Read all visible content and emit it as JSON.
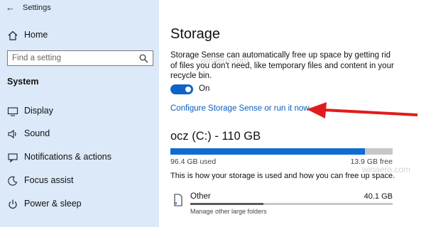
{
  "app": {
    "title": "Settings"
  },
  "sidebar": {
    "home_label": "Home",
    "search_placeholder": "Find a setting",
    "section_title": "System",
    "items": [
      {
        "label": "Display",
        "icon": "display-icon"
      },
      {
        "label": "Sound",
        "icon": "sound-icon"
      },
      {
        "label": "Notifications & actions",
        "icon": "notifications-icon"
      },
      {
        "label": "Focus assist",
        "icon": "focus-assist-icon"
      },
      {
        "label": "Power & sleep",
        "icon": "power-icon"
      }
    ]
  },
  "main": {
    "title": "Storage",
    "description": "Storage Sense can automatically free up space by getting rid of files you don't need, like temporary files and content in your recycle bin.",
    "toggle": {
      "state_label": "On",
      "on": true
    },
    "configure_link": "Configure Storage Sense or run it now",
    "drive": {
      "title": "ocz (C:) - 110 GB",
      "used_label": "96.4 GB used",
      "free_label": "13.9 GB free",
      "used_fraction": 0.874
    },
    "usage_hint": "This is how your storage is used and how you can free up space.",
    "categories": [
      {
        "name": "Other",
        "size": "40.1 GB",
        "subtitle": "Manage other large folders",
        "fraction": 0.36
      }
    ]
  },
  "watermark": {
    "text": "winaero.com",
    "letter": "W"
  },
  "colors": {
    "accent": "#0f63c9",
    "sidebar_bg": "#dbe9f8",
    "arrow": "#e11b1b"
  }
}
